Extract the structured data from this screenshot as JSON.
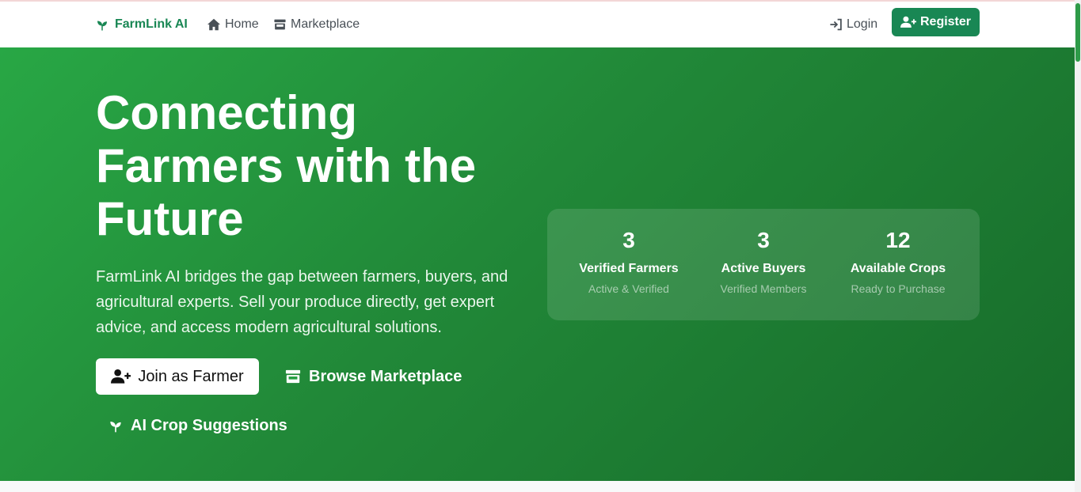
{
  "colors": {
    "brand": "#198754",
    "hero_start": "#28a745",
    "hero_end": "#176b2a"
  },
  "nav": {
    "brand_name": "FarmLink AI",
    "brand_icon": "seedling-icon",
    "links": [
      {
        "label": "Home",
        "icon": "home-icon"
      },
      {
        "label": "Marketplace",
        "icon": "store-icon"
      }
    ],
    "login_label": "Login",
    "register_label": "Register"
  },
  "hero": {
    "title": "Connecting Farmers with the Future",
    "description": "FarmLink AI bridges the gap between farmers, buyers, and agricultural experts. Sell your produce directly, get expert advice, and access modern agricultural solutions.",
    "buttons": {
      "join": "Join as Farmer",
      "browse": "Browse Marketplace",
      "ai": "AI Crop Suggestions"
    }
  },
  "stats": [
    {
      "number": "3",
      "label": "Verified Farmers",
      "sub": "Active & Verified"
    },
    {
      "number": "3",
      "label": "Active Buyers",
      "sub": "Verified Members"
    },
    {
      "number": "12",
      "label": "Available Crops",
      "sub": "Ready to Purchase"
    }
  ]
}
